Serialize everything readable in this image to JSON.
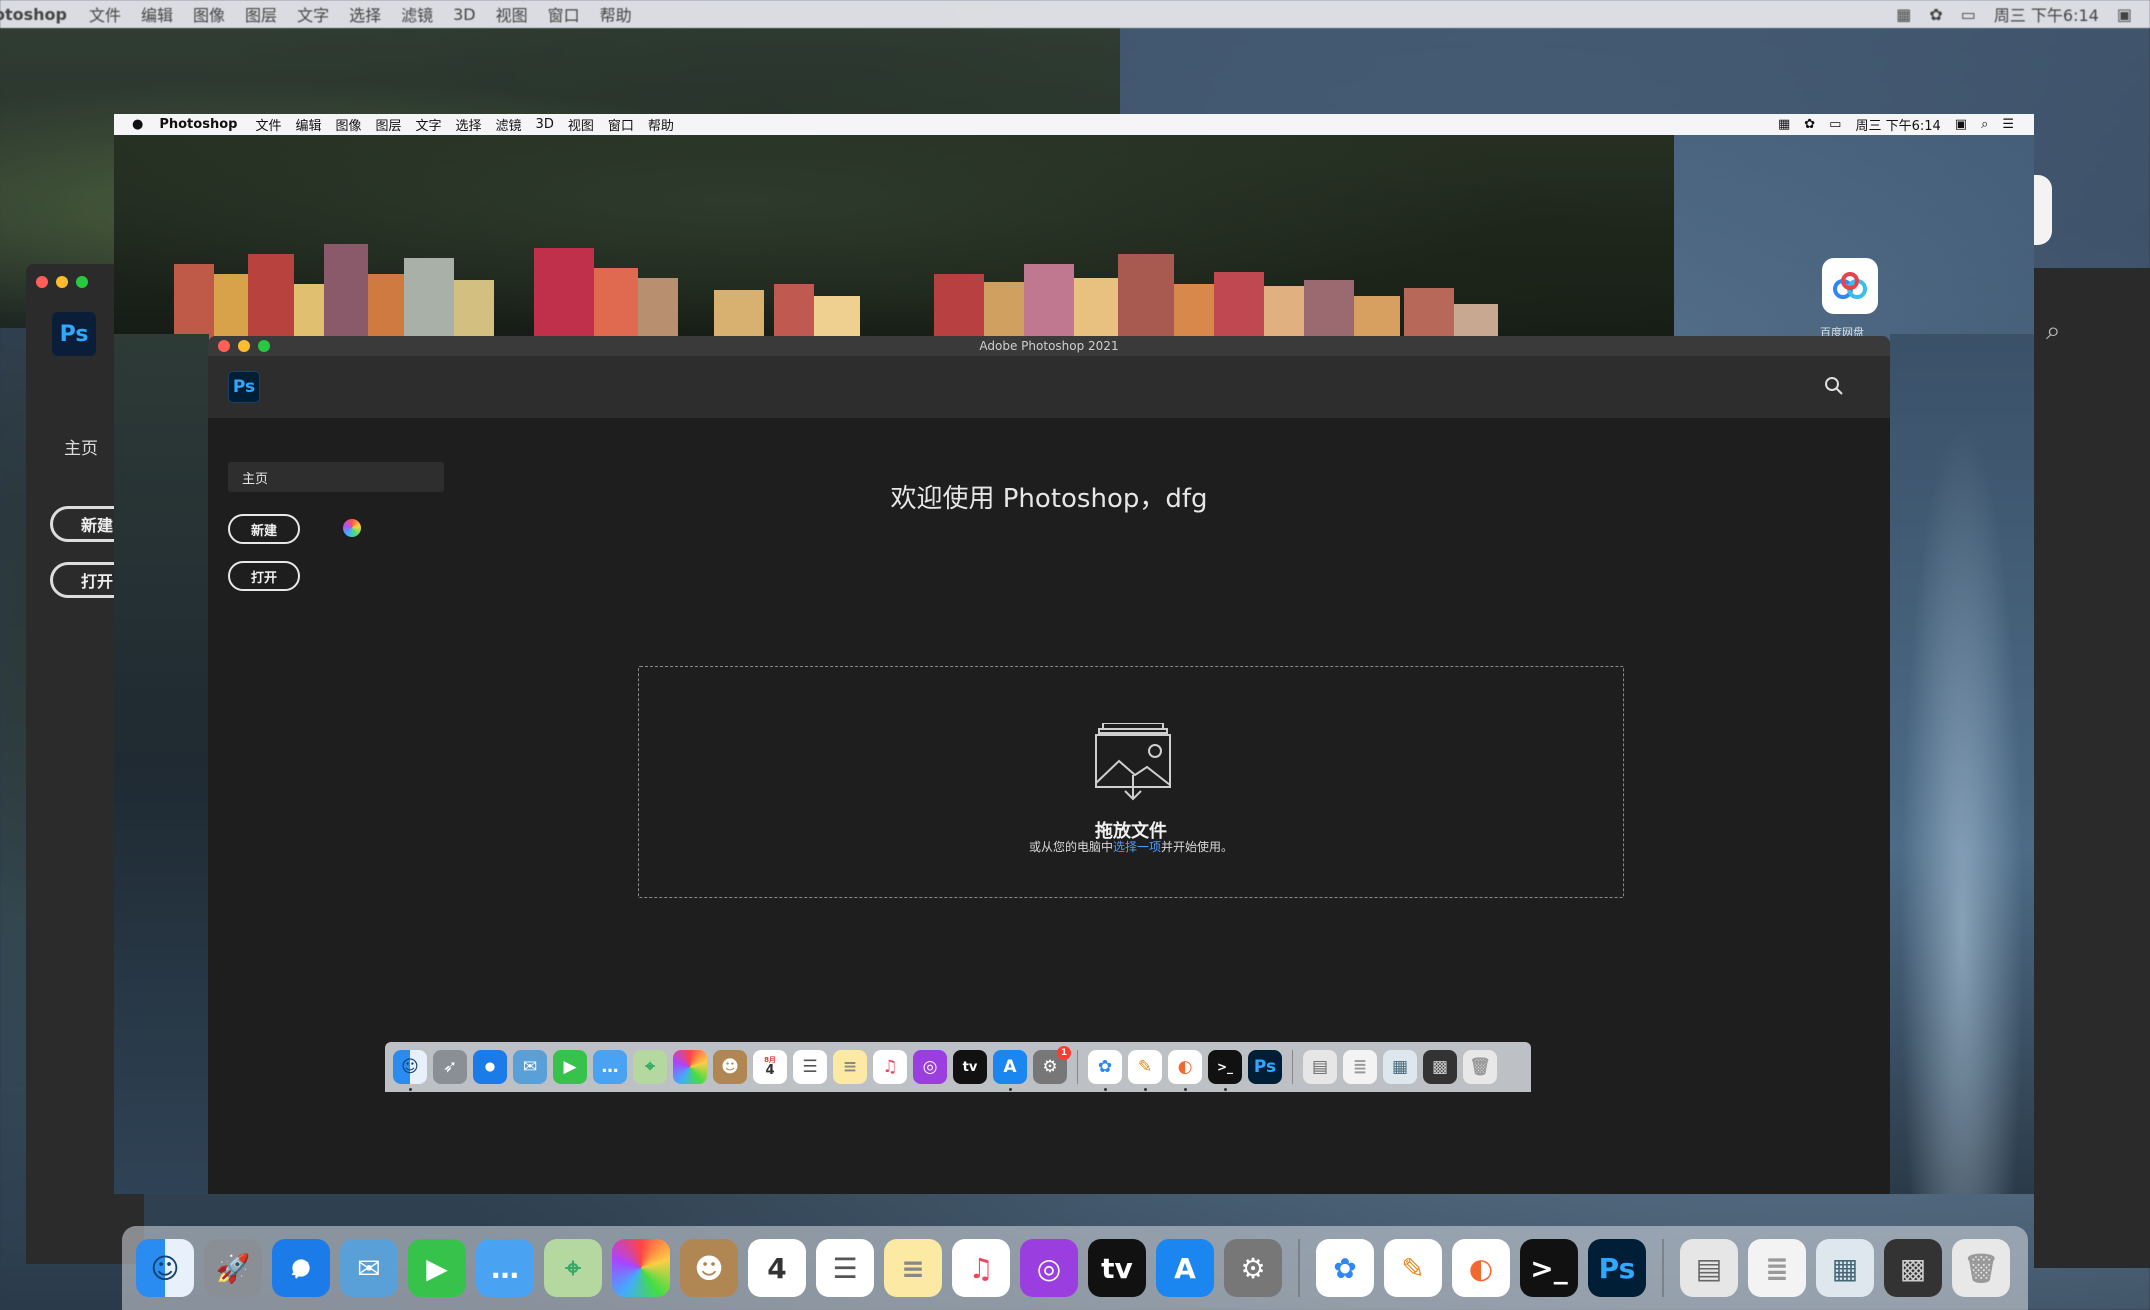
{
  "outer": {
    "menubar": {
      "app_name": "otoshop",
      "menus": [
        "文件",
        "编辑",
        "图像",
        "图层",
        "文字",
        "选择",
        "滤镜",
        "3D",
        "视图",
        "窗口",
        "帮助"
      ],
      "clock": "周三 下午6:14"
    },
    "left_window": {
      "logo": "Ps",
      "home_label": "主页",
      "new_label": "新建",
      "open_label": "打开"
    },
    "dock_icons": [
      "finder-icon",
      "launchpad-icon",
      "safari-icon",
      "mail-icon",
      "facetime-icon",
      "messages-icon",
      "maps-icon",
      "photos-icon",
      "contacts-icon",
      "calendar-icon",
      "reminders-icon",
      "notes-icon",
      "music-icon",
      "podcasts-icon",
      "tv-icon",
      "app-store-icon",
      "system-preferences-icon",
      "baidu-netdisk-icon",
      "pencil-app-icon",
      "donut-app-icon",
      "terminal-icon",
      "photoshop-icon",
      "document-icon",
      "stack-1-icon",
      "stack-2-icon",
      "stack-3-icon",
      "trash-icon"
    ]
  },
  "menubar": {
    "app_name": "Photoshop",
    "menus": [
      "文件",
      "编辑",
      "图像",
      "图层",
      "文字",
      "选择",
      "滤镜",
      "3D",
      "视图",
      "窗口",
      "帮助"
    ],
    "clock": "周三 下午6:14"
  },
  "desktop": {
    "baidu_label": "百度网盘"
  },
  "window": {
    "title": "Adobe Photoshop 2021",
    "logo": "Ps"
  },
  "sidebar": {
    "home_label": "主页",
    "new_label": "新建",
    "open_label": "打开"
  },
  "main": {
    "welcome": "欢迎使用 Photoshop，dfg",
    "drop_title": "拖放文件",
    "drop_sub_before": "或从您的电脑中",
    "drop_sub_link": "选择一项",
    "drop_sub_after": "并开始使用。"
  },
  "dock": {
    "calendar_month": "8月",
    "calendar_day": "4",
    "tv_label": "tv",
    "ps_label": "Ps",
    "system_pref_badge": "1"
  },
  "colors": {
    "ps_blue": "#31a8ff",
    "link_blue": "#4f9cff",
    "window_bg": "#1e1e1e",
    "header_bg": "#2d2d2d"
  }
}
